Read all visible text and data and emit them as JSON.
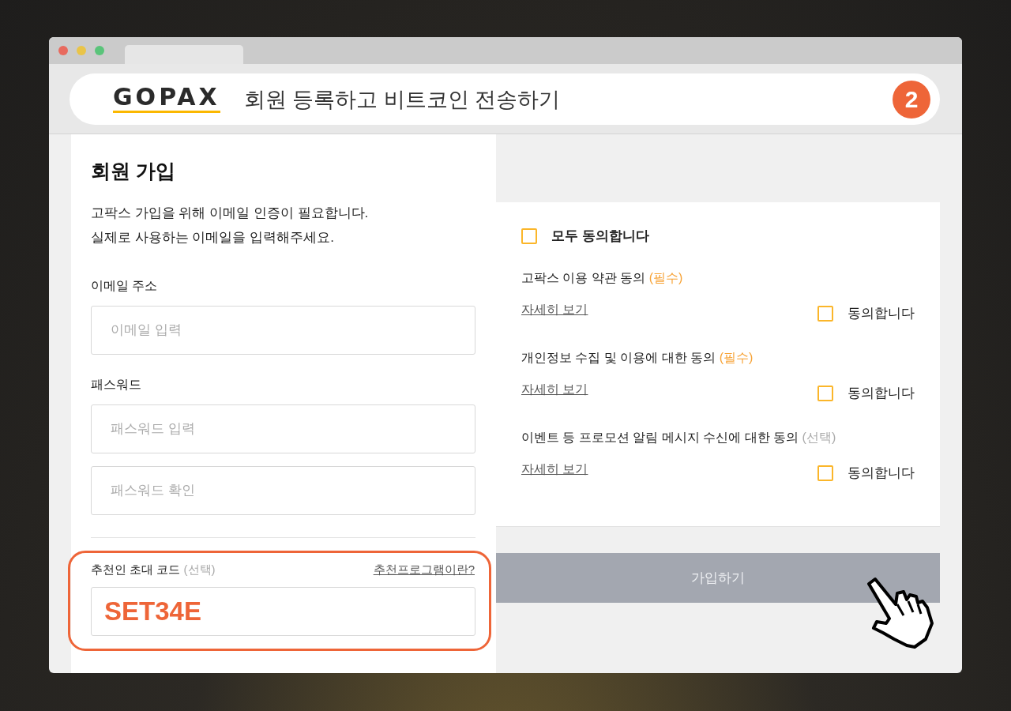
{
  "browser": {
    "logo": "GOPAX",
    "title": "회원 등록하고 비트코인 전송하기",
    "step_badge": "2"
  },
  "signup": {
    "title": "회원 가입",
    "description": [
      "고팍스 가입을 위해 이메일 인증이 필요합니다.",
      "실제로 사용하는 이메일을 입력해주세요."
    ],
    "fields": [
      {
        "label": "이메일 주소",
        "inputs": [
          {
            "placeholder": "이메일 입력"
          }
        ]
      },
      {
        "label": "패스워드",
        "inputs": [
          {
            "placeholder": "패스워드 입력"
          },
          {
            "placeholder": "패스워드 확인"
          }
        ]
      }
    ],
    "referral": {
      "label": "추천인 초대 코드",
      "tag": "(선택)",
      "link": "추천프로그램이란?",
      "value": "SET34E",
      "highlighted": true
    }
  },
  "terms": {
    "agree_all": {
      "label": "모두 동의합니다",
      "checked": false
    },
    "items": [
      {
        "title": "고팍스 이용 약관 동의",
        "tag": "(필수)",
        "required": true,
        "link": "자세히 보기",
        "agree_label": "동의합니다",
        "checked": false
      },
      {
        "title": "개인정보 수집 및 이용에 대한 동의",
        "tag": "(필수)",
        "required": true,
        "link": "자세히 보기",
        "agree_label": "동의합니다",
        "checked": false
      },
      {
        "title": "이벤트 등 프로모션 알림 메시지 수신에 대한 동의",
        "tag": "(선택)",
        "required": false,
        "link": "자세히 보기",
        "agree_label": "동의합니다",
        "checked": false
      }
    ],
    "submit": "가입하기"
  }
}
